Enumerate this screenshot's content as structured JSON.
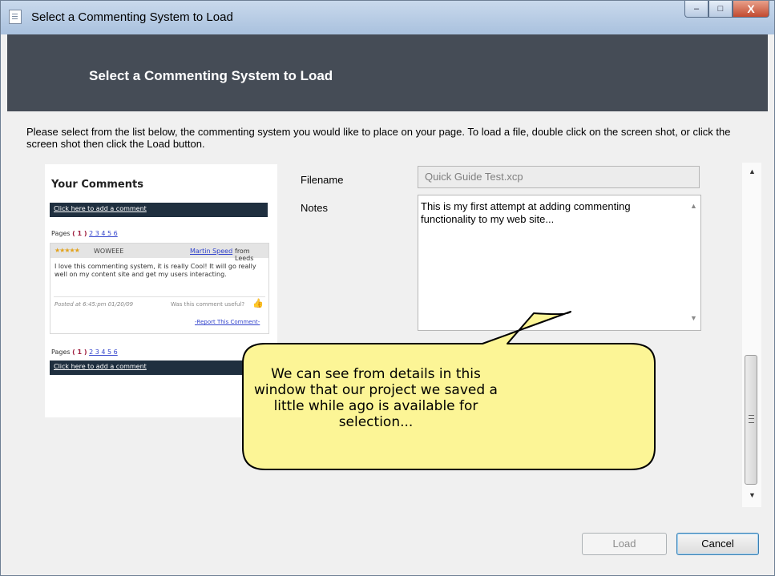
{
  "window": {
    "title": "Select a Commenting System to Load",
    "controls": {
      "minimize": "–",
      "maximize": "□",
      "close": "X"
    }
  },
  "header": {
    "title": "Select a Commenting System to Load"
  },
  "instructions": "Please select from the list below, the commenting system you would like to place on your page. To load a file, double click on the screen shot, or click the screen shot then click the Load button.",
  "preview": {
    "title": "Your Comments",
    "add_comment_link": "Click here to add a comment",
    "pages_label": "Pages",
    "current_page": "( 1 )",
    "page_links": "2 3 4 5 6",
    "comment": {
      "stars": "★★★★★",
      "rating_label": "WOWEEE",
      "author": "Martin Speed",
      "from": "from Leeds",
      "body": "I love this commenting system, it is really Cool! It will go really well on my content site and get my users interacting.",
      "posted": "Posted at 6:45:pm 01/20/09",
      "useful": "Was this comment useful?",
      "report": "-Report This Comment-"
    }
  },
  "fields": {
    "filename_label": "Filename",
    "filename_value": "Quick Guide Test.xcp",
    "notes_label": "Notes",
    "notes_value": "This is my first attempt at adding commenting functionality to my web site..."
  },
  "callout": "We can see from details in this window that our project we saved a little while ago is available for selection...",
  "buttons": {
    "load": "Load",
    "cancel": "Cancel"
  },
  "icons": {
    "scroll_up": "▲",
    "scroll_down": "▼"
  }
}
